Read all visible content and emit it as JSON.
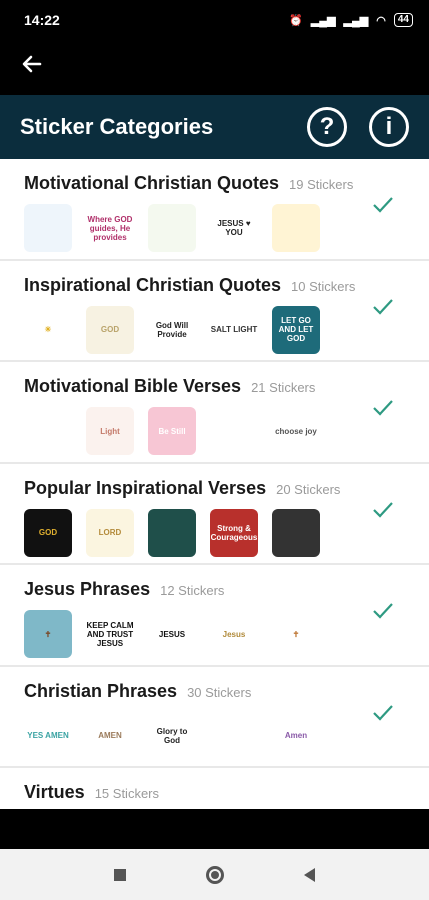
{
  "status": {
    "time": "14:22",
    "battery": "44"
  },
  "appbar": {
    "title": "Sticker Categories",
    "help_icon": "?",
    "info_icon": "i"
  },
  "categories": [
    {
      "title": "Motivational Christian Quotes",
      "count": "19 Stickers",
      "stickers": [
        {
          "text": "",
          "bg": "#eef5fb",
          "color": "#6a8cab"
        },
        {
          "text": "Where GOD guides, He provides",
          "bg": "#fff",
          "color": "#b0306a"
        },
        {
          "text": "",
          "bg": "#f4f9ef",
          "color": "#6a9a4a"
        },
        {
          "text": "JESUS ♥ YOU",
          "bg": "#fff",
          "color": "#222"
        },
        {
          "text": "",
          "bg": "#fff4d4",
          "color": "#c09a30"
        }
      ]
    },
    {
      "title": "Inspirational Christian Quotes",
      "count": "10 Stickers",
      "stickers": [
        {
          "text": "☀",
          "bg": "#fff",
          "color": "#e0b020"
        },
        {
          "text": "GOD",
          "bg": "#f7f2e2",
          "color": "#b9a36a"
        },
        {
          "text": "God Will Provide",
          "bg": "#fff",
          "color": "#222"
        },
        {
          "text": "SALT LIGHT",
          "bg": "#fff",
          "color": "#333"
        },
        {
          "text": "LET GO AND LET GOD",
          "bg": "#1e6b7a",
          "color": "#fff"
        }
      ]
    },
    {
      "title": "Motivational Bible Verses",
      "count": "21 Stickers",
      "stickers": [
        {
          "text": "",
          "bg": "#fff",
          "color": "#555"
        },
        {
          "text": "Light",
          "bg": "#fbf2ee",
          "color": "#c47a6a"
        },
        {
          "text": "Be Still",
          "bg": "#f7c6d4",
          "color": "#fff"
        },
        {
          "text": "",
          "bg": "#fff",
          "color": "#444"
        },
        {
          "text": "choose joy",
          "bg": "#fff",
          "color": "#555"
        }
      ]
    },
    {
      "title": "Popular Inspirational Verses",
      "count": "20 Stickers",
      "stickers": [
        {
          "text": "GOD",
          "bg": "#111",
          "color": "#e0b030"
        },
        {
          "text": "LORD",
          "bg": "#fbf5e0",
          "color": "#b38a3a"
        },
        {
          "text": "",
          "bg": "#1f4f4a",
          "color": "#fff"
        },
        {
          "text": "Strong & Courageous",
          "bg": "#b8302c",
          "color": "#fff"
        },
        {
          "text": "",
          "bg": "#333",
          "color": "#fff"
        }
      ]
    },
    {
      "title": "Jesus Phrases",
      "count": "12 Stickers",
      "stickers": [
        {
          "text": "✝",
          "bg": "#7fb8c8",
          "color": "#7a4a2a"
        },
        {
          "text": "KEEP CALM AND TRUST JESUS",
          "bg": "#fff",
          "color": "#111"
        },
        {
          "text": "JESUS",
          "bg": "#fff",
          "color": "#111"
        },
        {
          "text": "Jesus",
          "bg": "#fff",
          "color": "#b08a3a"
        },
        {
          "text": "✝",
          "bg": "#fff",
          "color": "#c07a3a"
        }
      ]
    },
    {
      "title": "Christian Phrases",
      "count": "30 Stickers",
      "stickers": [
        {
          "text": "YES AMEN",
          "bg": "#fff",
          "color": "#3aa3a3"
        },
        {
          "text": "AMEN",
          "bg": "#fff",
          "color": "#9a7a5a"
        },
        {
          "text": "Glory to God",
          "bg": "#fff",
          "color": "#222"
        },
        {
          "text": "",
          "bg": "#fff",
          "color": "#b02020"
        },
        {
          "text": "Amen",
          "bg": "#fff",
          "color": "#8a5aa8"
        }
      ]
    },
    {
      "title": "Virtues",
      "count": "15 Stickers",
      "stickers": []
    }
  ]
}
